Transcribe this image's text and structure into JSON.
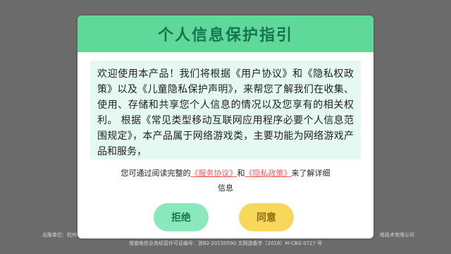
{
  "background_footer": {
    "publisher_prefix": "出版单位：杭州",
    "company_suffix": "络技术有限公司",
    "license_line": "增值电信业务经营许可证编号：浙B2-20150590    文网游备字〔2018〕M-CBG 0727 号"
  },
  "dialog": {
    "title": "个人信息保护指引",
    "body_text": "欢迎使用本产品！我们将根据《用户协议》和《隐私权政策》以及《儿童隐私保护声明》，来帮您了解我们在收集、使用、存储和共享您个人信息的情况以及您享有的相关权利。  根据《常见类型移动互联网应用程序必要个人信息范围规定》，本产品属于网络游戏类，主要功能为网络游戏产品和服务，",
    "consent_prefix": "您可通过阅读完整的",
    "service_agreement_link": "《服务协议》",
    "and_text": "和",
    "privacy_policy_link": "《隐私政策》",
    "consent_suffix": "来了解详细",
    "consent_line2": "信息",
    "reject_label": "拒绝",
    "agree_label": "同意"
  },
  "colors": {
    "header_bg": "#5ed99a",
    "title_color": "#17744d",
    "body_bg": "#e5f8f1",
    "link_color": "#f05a57",
    "reject_bg": "#8be8bc",
    "agree_bg": "#f8d85a",
    "overlay": "#6b6b6b"
  }
}
